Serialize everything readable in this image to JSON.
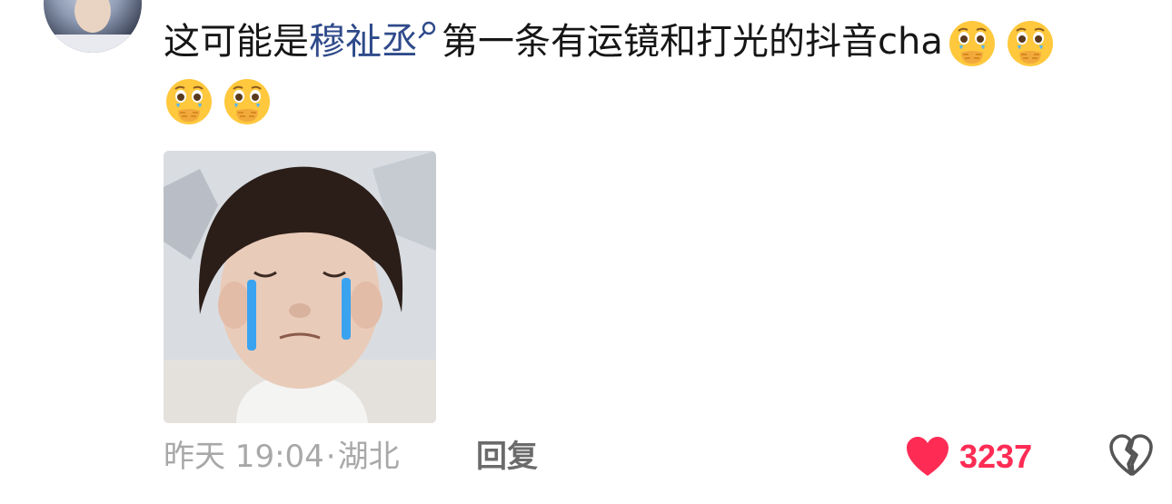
{
  "comment": {
    "text_before": "这可能是",
    "mention": "穆祉丞",
    "text_after": "第一条有运镜和打光的抖音cha",
    "emoji_count": 4,
    "emoji_name": "face-holding-back-tears"
  },
  "meta": {
    "time": "昨天 19:04",
    "separator": "·",
    "location": "湖北"
  },
  "actions": {
    "reply_label": "回复",
    "like_count": "3237",
    "like_color": "#fe2c55"
  },
  "icons": {
    "mention_search": "search-icon",
    "like": "heart-icon",
    "dislike": "broken-heart-icon"
  }
}
